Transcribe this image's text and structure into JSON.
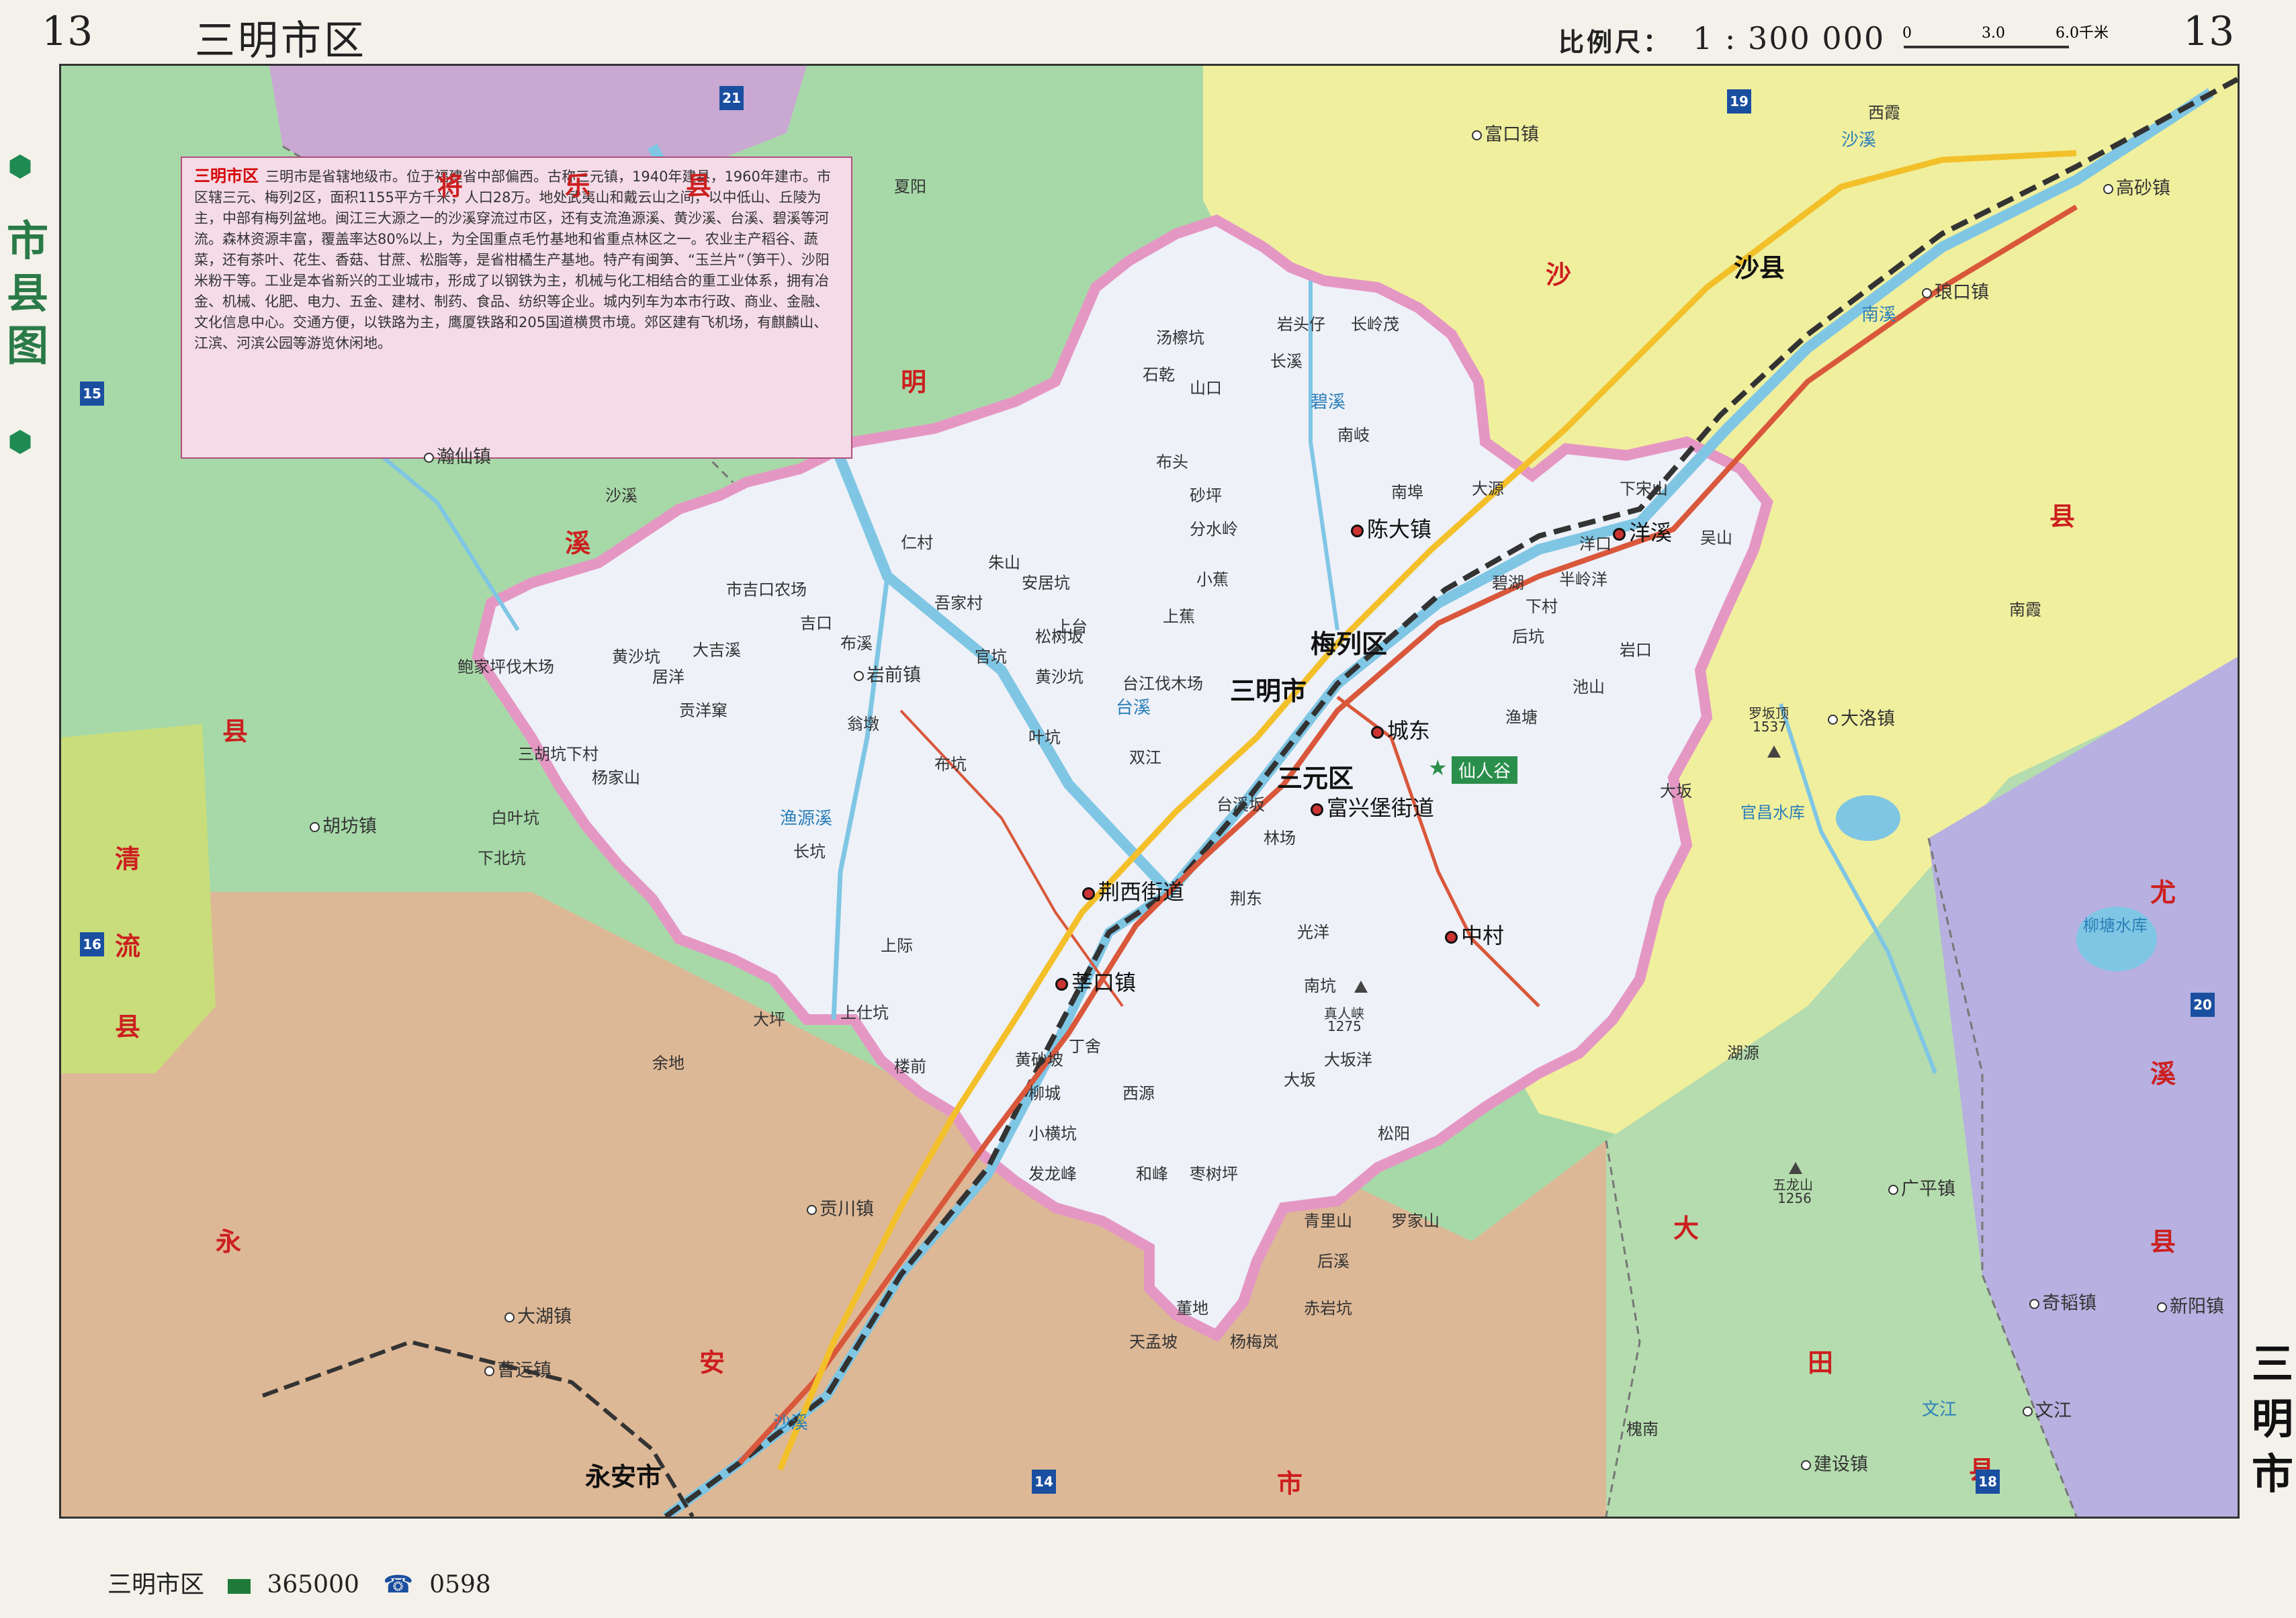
{
  "header": {
    "page_left": "13",
    "title": "三明市区",
    "scale_label": "比例尺：",
    "scale_value": "1 : 300 000",
    "scalebar": {
      "t0": "0",
      "t1": "3.0",
      "t2": "6.0千米"
    },
    "page_right": "13"
  },
  "side_label": "市县图",
  "right_city": "三明市",
  "intro": {
    "title": "三明市区",
    "text": "三明市是省辖地级市。位于福建省中部偏西。古称三元镇，1940年建县，1960年建市。市区辖三元、梅列2区，面积1155平方千米，人口28万。地处武夷山和戴云山之间，以中低山、丘陵为主，中部有梅列盆地。闽江三大源之一的沙溪穿流过市区，还有支流渔源溪、黄沙溪、台溪、碧溪等河流。森林资源丰富，覆盖率达80%以上，为全国重点毛竹基地和省重点林区之一。农业主产稻谷、蔬菜，还有茶叶、花生、香菇、甘蔗、松脂等，是省柑橘生产基地。特产有闽笋、“玉兰片”（笋干）、沙阳米粉干等。工业是本省新兴的工业城市，形成了以钢铁为主，机械与化工相结合的重工业体系，拥有冶金、机械、化肥、电力、五金、建材、制药、食品、纺织等企业。城内列车为本市行政、商业、金融、文化信息中心。交通方便，以铁路为主，鹰厦铁路和205国道横贯市境。郊区建有飞机场，有麒麟山、江滨、河滨公园等游览休闲地。"
  },
  "colors": {
    "sanming": "#eef1f8",
    "jiangle": "#c9a8d2",
    "mingxi": "#a7d9a8",
    "qingliu": "#c9dd7a",
    "shaxian": "#f0ef9e",
    "yongan": "#ddb896",
    "datian": "#b5dcae",
    "youxi": "#b7b0e0",
    "border_pink": "#e597c4",
    "river": "#7fc6e4",
    "road_red": "#d9573b",
    "rail": "#333333",
    "highway": "#f3c02a"
  },
  "regions": [
    {
      "name": "将乐县",
      "chars": [
        "将",
        "乐",
        "县"
      ]
    },
    {
      "name": "明溪县",
      "chars": [
        "明",
        "溪",
        "县"
      ]
    },
    {
      "name": "清流县",
      "chars": [
        "清",
        "流",
        "县"
      ]
    },
    {
      "name": "沙县",
      "chars": [
        "沙",
        "县"
      ]
    },
    {
      "name": "永安市",
      "chars": [
        "永",
        "安",
        "市"
      ]
    },
    {
      "name": "大田县",
      "chars": [
        "大",
        "田",
        "县"
      ]
    },
    {
      "name": "尤溪县",
      "chars": [
        "尤",
        "溪",
        "县"
      ]
    }
  ],
  "main_cities": [
    "三明市",
    "梅列区",
    "三元区",
    "沙县",
    "永安市"
  ],
  "scenic": "仙人谷",
  "towns": [
    "富口镇",
    "西霞",
    "高砂镇",
    "琅口镇",
    "南霞",
    "大洛镇",
    "湖源",
    "广平镇",
    "奇韬镇",
    "新阳镇",
    "建设镇",
    "文江",
    "贡川镇",
    "大湖镇",
    "曹远镇",
    "槐南",
    "胡坊镇",
    "瀚仙镇",
    "沙溪",
    "夏阳",
    "岩前镇",
    "中村",
    "莘口镇",
    "荆西街道",
    "陈大镇",
    "洋溪",
    "城东",
    "富兴堡街道",
    "洋口",
    "下宋山",
    "吴山",
    "渔塘",
    "上台",
    "仁村",
    "朱山",
    "安居坑",
    "吾家村",
    "黄沙坑",
    "松树坂",
    "官坑",
    "台江伐木场",
    "双江",
    "叶坑",
    "翁墩",
    "台溪坂",
    "林场",
    "布坑",
    "大源",
    "荆东",
    "光洋",
    "南坑",
    "大坂洋",
    "松阳",
    "罗家山",
    "青里山",
    "后溪",
    "赤岩坑",
    "杨梅岚",
    "董地",
    "天孟坡",
    "和峰",
    "发龙峰",
    "枣树坪",
    "小横坑",
    "柳城",
    "西源",
    "丁舍",
    "黄砂坡",
    "楼前",
    "上仕坑",
    "大坪",
    "余地",
    "下北坑",
    "白叶坑",
    "三胡坑下村",
    "杨家山",
    "贡洋窠",
    "居洋",
    "黄沙坑",
    "大吉溪",
    "市吉口农场",
    "鲍家坪伐木场",
    "布溪",
    "长坑",
    "吉口",
    "上际",
    "大坂",
    "南埠",
    "长溪",
    "岩头仔",
    "汤檫坑",
    "石乾",
    "山口",
    "长岭茂",
    "南岐",
    "布头",
    "砂坪",
    "分水岭",
    "小蕉",
    "上蕉",
    "碧湖",
    "下村",
    "半岭洋",
    "后坑",
    "岩口",
    "池山",
    "大坂"
  ],
  "rivers": [
    "沙溪",
    "沙溪",
    "渔源溪",
    "碧溪",
    "台溪",
    "南溪",
    "文江"
  ],
  "route_badges": [
    "21",
    "19",
    "15",
    "16",
    "20",
    "14",
    "18"
  ],
  "reservoirs": [
    "官昌水库",
    "柳塘水库"
  ],
  "peaks": [
    {
      "name": "真人峡",
      "elev": "1275"
    },
    {
      "name": "罗坂顶",
      "elev": "1537"
    },
    {
      "name": "五龙山",
      "elev": "1256"
    }
  ],
  "footer": {
    "name": "三明市区",
    "postcode": "365000",
    "areacode": "0598"
  }
}
